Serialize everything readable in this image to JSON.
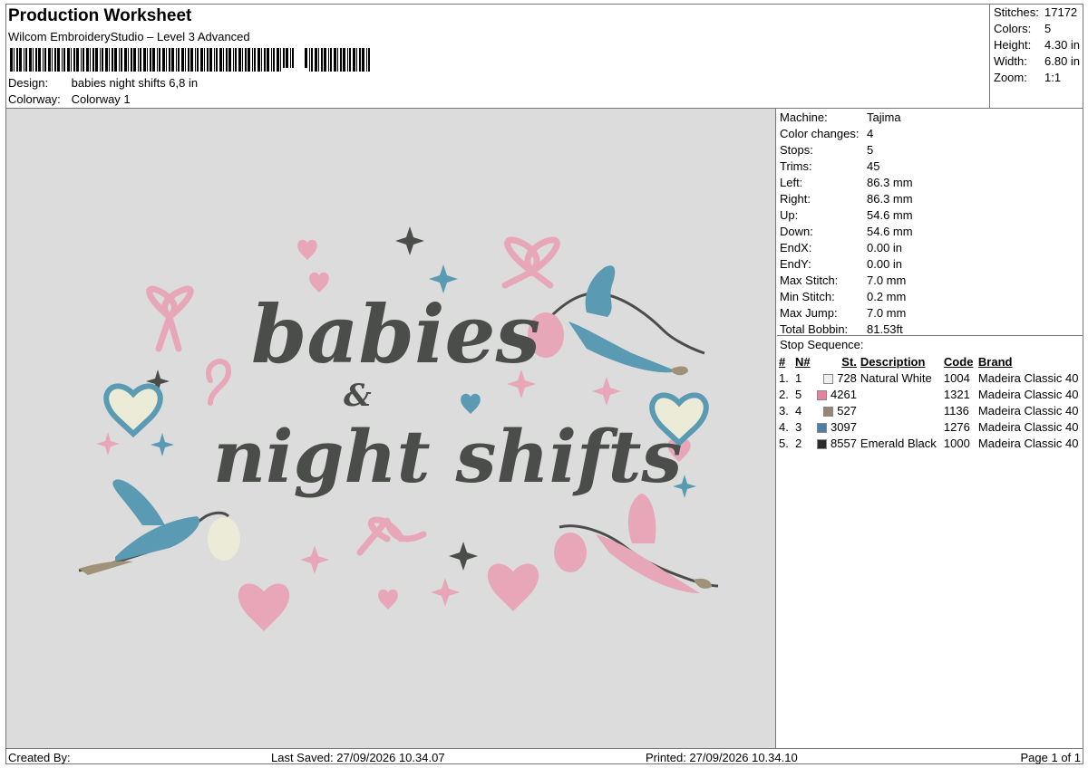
{
  "header": {
    "title": "Production Worksheet",
    "software": "Wilcom EmbroideryStudio – Level 3 Advanced",
    "design_label": "Design:",
    "design_value": "babies night shifts 6,8 in",
    "colorway_label": "Colorway:",
    "colorway_value": "Colorway 1"
  },
  "summary": [
    {
      "label": "Stitches:",
      "value": "17172"
    },
    {
      "label": "Colors:",
      "value": "5"
    },
    {
      "label": "Height:",
      "value": "4.30 in"
    },
    {
      "label": "Width:",
      "value": "6.80 in"
    },
    {
      "label": "Zoom:",
      "value": "1:1"
    }
  ],
  "machine_info": [
    {
      "label": "Machine:",
      "value": "Tajima"
    },
    {
      "label": "Color changes:",
      "value": "4"
    },
    {
      "label": "Stops:",
      "value": "5"
    },
    {
      "label": "Trims:",
      "value": "45"
    },
    {
      "label": "Left:",
      "value": "86.3 mm"
    },
    {
      "label": "Right:",
      "value": "86.3 mm"
    },
    {
      "label": "Up:",
      "value": "54.6 mm"
    },
    {
      "label": "Down:",
      "value": "54.6 mm"
    },
    {
      "label": "EndX:",
      "value": "0.00 in"
    },
    {
      "label": "EndY:",
      "value": "0.00 in"
    },
    {
      "label": "Max Stitch:",
      "value": "7.0 mm"
    },
    {
      "label": "Min Stitch:",
      "value": "0.2 mm"
    },
    {
      "label": "Max Jump:",
      "value": "7.0 mm"
    },
    {
      "label": "Total Bobbin:",
      "value": "81.53ft"
    }
  ],
  "stop_sequence": {
    "label": "Stop Sequence:",
    "columns": [
      "#",
      "N#",
      "St.",
      "Description",
      "Code",
      "Brand"
    ],
    "rows": [
      {
        "num": "1.",
        "n": "1",
        "color": "#efefef",
        "st": "728",
        "desc": "Natural White",
        "code": "1004",
        "brand": "Madeira Classic 40"
      },
      {
        "num": "2.",
        "n": "5",
        "color": "#e3839f",
        "st": "4261",
        "desc": "",
        "code": "1321",
        "brand": "Madeira Classic 40"
      },
      {
        "num": "3.",
        "n": "4",
        "color": "#9a8473",
        "st": "527",
        "desc": "",
        "code": "1136",
        "brand": "Madeira Classic 40"
      },
      {
        "num": "4.",
        "n": "3",
        "color": "#4f7fa2",
        "st": "3097",
        "desc": "",
        "code": "1276",
        "brand": "Madeira Classic 40"
      },
      {
        "num": "5.",
        "n": "2",
        "color": "#2b2b2b",
        "st": "8557",
        "desc": "Emerald Black",
        "code": "1000",
        "brand": "Madeira Classic 40"
      }
    ]
  },
  "design_text": {
    "line1": "babies",
    "amp": "&",
    "line2": "night shifts"
  },
  "colors": {
    "text": "#4a4d4a",
    "pink": "#e7a7b9",
    "blue": "#5a9bb3",
    "cream": "#ecebd8",
    "tan": "#9f9278",
    "canvas": "#dcdcdc"
  },
  "footer": {
    "created_by": "Created By:",
    "last_saved": "Last Saved: 27/09/2026 10.34.07",
    "printed": "Printed: 27/09/2026 10.34.10",
    "page": "Page 1 of 1"
  }
}
